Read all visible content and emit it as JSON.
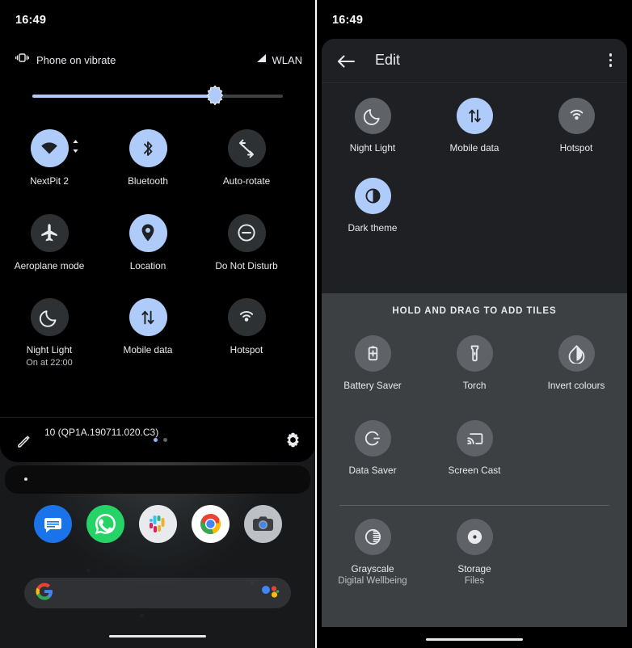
{
  "left_panel": {
    "status_bar": {
      "time": "16:49",
      "vibrate_label": "Phone on vibrate",
      "network_label": "WLAN"
    },
    "brightness": {
      "value_pct": 73
    },
    "tiles": [
      {
        "label": "NextPit 2",
        "icon": "wifi-icon",
        "state": "on",
        "sub": ""
      },
      {
        "label": "Bluetooth",
        "icon": "bluetooth-icon",
        "state": "on",
        "sub": ""
      },
      {
        "label": "Auto-rotate",
        "icon": "auto-rotate-icon",
        "state": "off",
        "sub": ""
      },
      {
        "label": "Aeroplane mode",
        "icon": "airplane-icon",
        "state": "off",
        "sub": ""
      },
      {
        "label": "Location",
        "icon": "location-pin-icon",
        "state": "on",
        "sub": ""
      },
      {
        "label": "Do Not Disturb",
        "icon": "do-not-disturb-icon",
        "state": "off",
        "sub": ""
      },
      {
        "label": "Night Light",
        "icon": "moon-icon",
        "state": "off",
        "sub": "On at 22:00"
      },
      {
        "label": "Mobile data",
        "icon": "mobile-data-icon",
        "state": "on",
        "sub": ""
      },
      {
        "label": "Hotspot",
        "icon": "hotspot-icon",
        "state": "off",
        "sub": ""
      }
    ],
    "footer": {
      "build": "10 (QP1A.190711.020.C3)",
      "pages": 2,
      "active_page": 1
    },
    "dock_apps": [
      "messages-app",
      "whatsapp-app",
      "slack-app",
      "chrome-app",
      "camera-app"
    ],
    "search_bar": {
      "placeholder": ""
    }
  },
  "right_panel": {
    "status_bar": {
      "time": "16:49"
    },
    "app_bar": {
      "title": "Edit",
      "back_icon": "arrow-back-icon",
      "overflow_icon": "more-vert-icon"
    },
    "current_tiles": [
      {
        "label": "Night Light",
        "icon": "moon-icon",
        "state": "off"
      },
      {
        "label": "Mobile data",
        "icon": "mobile-data-icon",
        "state": "on"
      },
      {
        "label": "Hotspot",
        "icon": "hotspot-icon",
        "state": "off"
      },
      {
        "label": "Dark theme",
        "icon": "dark-theme-icon",
        "state": "on"
      }
    ],
    "add_section": {
      "header": "HOLD AND DRAG TO ADD TILES",
      "tiles": [
        {
          "label": "Battery Saver",
          "sub": "",
          "icon": "battery-saver-icon"
        },
        {
          "label": "Torch",
          "sub": "",
          "icon": "torch-icon"
        },
        {
          "label": "Invert colours",
          "sub": "",
          "icon": "invert-colours-icon"
        },
        {
          "label": "Data Saver",
          "sub": "",
          "icon": "data-saver-icon"
        },
        {
          "label": "Screen Cast",
          "sub": "",
          "icon": "screen-cast-icon"
        }
      ],
      "app_tiles": [
        {
          "label": "Grayscale",
          "sub": "Digital Wellbeing",
          "icon": "grayscale-icon"
        },
        {
          "label": "Storage",
          "sub": "Files",
          "icon": "storage-icon"
        }
      ]
    }
  },
  "colors": {
    "accent_on": "#aecbfa",
    "tile_off_left": "#2e3133",
    "tile_off_right": "#5f6368",
    "sheet_bg": "#1f2023",
    "add_bg": "#3c4043",
    "text": "#e8eaed"
  }
}
